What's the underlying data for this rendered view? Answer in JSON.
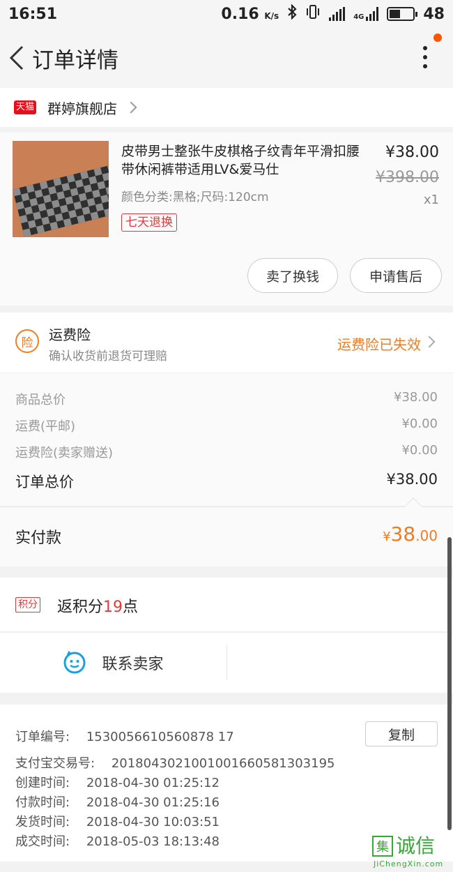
{
  "status_bar": {
    "time": "16:51",
    "net_speed": "0.16",
    "net_unit": "K/s",
    "network_type": "4G",
    "battery": "48",
    "battery_level": 0.48,
    "icons": [
      "bluetooth-icon",
      "vibrate-icon",
      "signal-icon",
      "battery-icon"
    ]
  },
  "header": {
    "title": "订单详情",
    "back_icon": "chevron-left-icon",
    "more_icon": "more-vertical-icon",
    "accent": "#ff5500"
  },
  "shop": {
    "badge": "天猫",
    "name": "群婷旗舰店"
  },
  "item": {
    "title": "皮带男士整张牛皮棋格子纹青年平滑扣腰带休闲裤带适用LV&爱马仕",
    "spec": "颜色分类:黑格;尺码:120cm",
    "tag": "七天退换",
    "price": "¥38.00",
    "original_price": "¥398.00",
    "quantity": "x1",
    "buttons": {
      "sell": "卖了换钱",
      "after_sale": "申请售后"
    }
  },
  "insurance": {
    "icon_text": "险",
    "title": "运费险",
    "subtitle": "确认收货前退货可理赔",
    "status": "运费险已失效",
    "status_color": "#f07c22"
  },
  "price_summary": {
    "rows": [
      {
        "label": "商品总价",
        "value": "¥38.00"
      },
      {
        "label": "运费(平邮)",
        "value": "¥0.00"
      },
      {
        "label": "运费险(卖家赠送)",
        "value": "¥0.00"
      }
    ],
    "total_label": "订单总价",
    "total_value": "¥38.00"
  },
  "paid": {
    "label": "实付款",
    "currency": "¥",
    "integer": "38",
    "decimal": ".00"
  },
  "points": {
    "badge": "积分",
    "prefix": "返积分",
    "value": "19",
    "suffix": "点"
  },
  "contact": {
    "label": "联系卖家",
    "icon": "chat-smiley-icon"
  },
  "order_info": {
    "order_no_label": "订单编号:",
    "order_no": "1530056610560878 17",
    "copy_label": "复制",
    "alipay_label": "支付宝交易号:",
    "alipay_no": "2018043021001001660581303195",
    "created_label": "创建时间:",
    "created": "2018-04-30 01:25:12",
    "paid_label": "付款时间:",
    "paid": "2018-04-30 01:25:16",
    "shipped_label": "发货时间:",
    "shipped": "2018-04-30 10:03:51",
    "completed_label": "成交时间:",
    "completed": "2018-05-03 18:13:48"
  },
  "watermark": {
    "logo_char": "集",
    "text": "诚信",
    "url": "JiChengXin.com"
  }
}
